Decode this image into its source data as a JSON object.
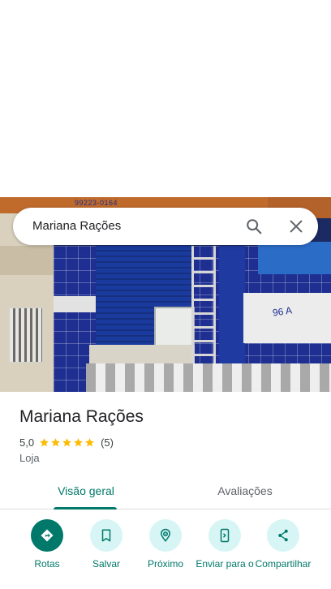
{
  "search": {
    "query": "Mariana Rações"
  },
  "photo": {
    "banner_text": "99223-0164",
    "wall_text": "96 A"
  },
  "place": {
    "name": "Mariana Rações",
    "rating": "5,0",
    "stars": 5,
    "review_count": "(5)",
    "category": "Loja"
  },
  "tabs": [
    {
      "label": "Visão geral",
      "active": true
    },
    {
      "label": "Avaliações",
      "active": false
    }
  ],
  "actions": [
    {
      "label": "Rotas",
      "icon": "directions-icon"
    },
    {
      "label": "Salvar",
      "icon": "bookmark-icon"
    },
    {
      "label": "Próximo",
      "icon": "nearby-icon"
    },
    {
      "label": "Enviar para o",
      "icon": "send-to-phone-icon"
    },
    {
      "label": "Compartilhar",
      "icon": "share-icon"
    }
  ],
  "colors": {
    "accent": "#00796b",
    "action_bg": "#d7f5f5",
    "star": "#fbbc04"
  }
}
